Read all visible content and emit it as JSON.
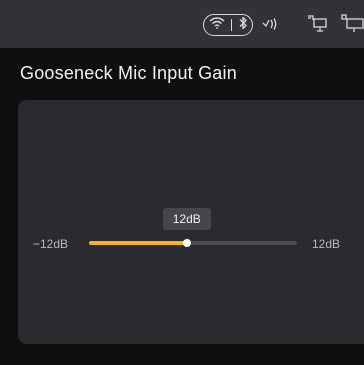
{
  "status_bar": {
    "icons": [
      "wifi-icon",
      "bluetooth-icon",
      "sound-waves-icon",
      "screen-share-icon",
      "monitor-icon"
    ]
  },
  "page": {
    "title": "Gooseneck Mic Input Gain"
  },
  "slider": {
    "min_label": "−12dB",
    "max_label": "12dB",
    "value_label": "12dB",
    "fill_fraction": 0.47,
    "colors": {
      "fill": "#f7b21e",
      "track": "#4c4d51"
    }
  }
}
